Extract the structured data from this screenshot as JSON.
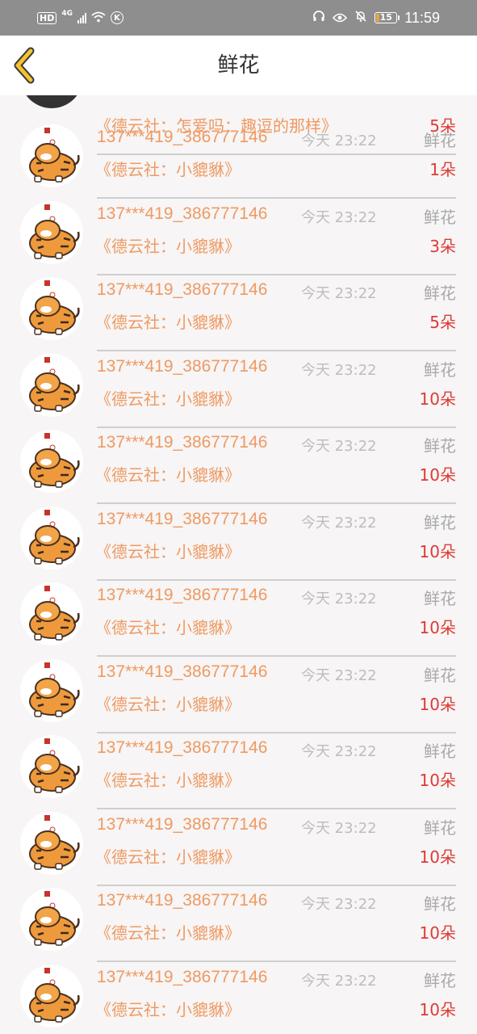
{
  "status_bar": {
    "left": [
      "HD",
      "4G"
    ],
    "battery_level": "15",
    "time": "11:59",
    "icons": [
      "headphones-icon",
      "eye-icon",
      "bell-off-icon",
      "battery-icon"
    ]
  },
  "header": {
    "back_icon": "chevron-left-icon",
    "title": "鲜花"
  },
  "colors": {
    "name": "#ee9a63",
    "quantity": "#dd3b35",
    "muted": "#bdbdbd",
    "back_chevron": "#f6c22d"
  },
  "partial_row": {
    "work": "《德云社：怎爱吗：趣逗的那样》",
    "quantity": "5朵"
  },
  "rows": [
    {
      "name": "137***419_386777146",
      "time": "今天 23:22",
      "type": "鲜花",
      "work": "《德云社：小貔貅》",
      "quantity": "1朵"
    },
    {
      "name": "137***419_386777146",
      "time": "今天 23:22",
      "type": "鲜花",
      "work": "《德云社：小貔貅》",
      "quantity": "3朵"
    },
    {
      "name": "137***419_386777146",
      "time": "今天 23:22",
      "type": "鲜花",
      "work": "《德云社：小貔貅》",
      "quantity": "5朵"
    },
    {
      "name": "137***419_386777146",
      "time": "今天 23:22",
      "type": "鲜花",
      "work": "《德云社：小貔貅》",
      "quantity": "10朵"
    },
    {
      "name": "137***419_386777146",
      "time": "今天 23:22",
      "type": "鲜花",
      "work": "《德云社：小貔貅》",
      "quantity": "10朵"
    },
    {
      "name": "137***419_386777146",
      "time": "今天 23:22",
      "type": "鲜花",
      "work": "《德云社：小貔貅》",
      "quantity": "10朵"
    },
    {
      "name": "137***419_386777146",
      "time": "今天 23:22",
      "type": "鲜花",
      "work": "《德云社：小貔貅》",
      "quantity": "10朵"
    },
    {
      "name": "137***419_386777146",
      "time": "今天 23:22",
      "type": "鲜花",
      "work": "《德云社：小貔貅》",
      "quantity": "10朵"
    },
    {
      "name": "137***419_386777146",
      "time": "今天 23:22",
      "type": "鲜花",
      "work": "《德云社：小貔貅》",
      "quantity": "10朵"
    },
    {
      "name": "137***419_386777146",
      "time": "今天 23:22",
      "type": "鲜花",
      "work": "《德云社：小貔貅》",
      "quantity": "10朵"
    },
    {
      "name": "137***419_386777146",
      "time": "今天 23:22",
      "type": "鲜花",
      "work": "《德云社：小貔貅》",
      "quantity": "10朵"
    },
    {
      "name": "137***419_386777146",
      "time": "今天 23:22",
      "type": "鲜花",
      "work": "《德云社：小貔貅》",
      "quantity": "10朵"
    }
  ]
}
